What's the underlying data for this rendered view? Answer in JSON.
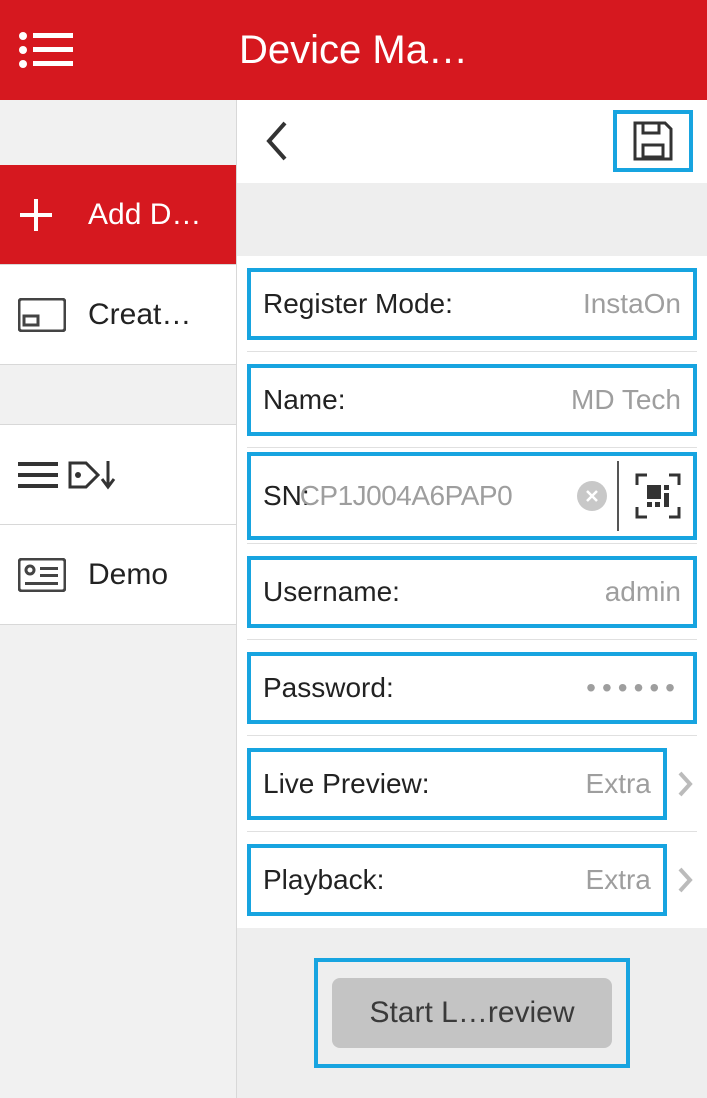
{
  "header": {
    "title": "Device Ma…"
  },
  "sidebar": {
    "add": {
      "label": "Add D…"
    },
    "create": {
      "label": "Creat…"
    },
    "demo": {
      "label": "Demo"
    }
  },
  "form": {
    "registerMode": {
      "label": "Register Mode:",
      "value": "InstaOn"
    },
    "name": {
      "label": "Name:",
      "value": "MD Tech"
    },
    "sn": {
      "label": "SN:",
      "value": "CP1J004A6PAP0"
    },
    "username": {
      "label": "Username:",
      "value": "admin"
    },
    "password": {
      "label": "Password:",
      "value": "••••••"
    },
    "livePreview": {
      "label": "Live Preview:",
      "value": "Extra"
    },
    "playback": {
      "label": "Playback:",
      "value": "Extra"
    }
  },
  "actions": {
    "start": "Start L…review"
  }
}
